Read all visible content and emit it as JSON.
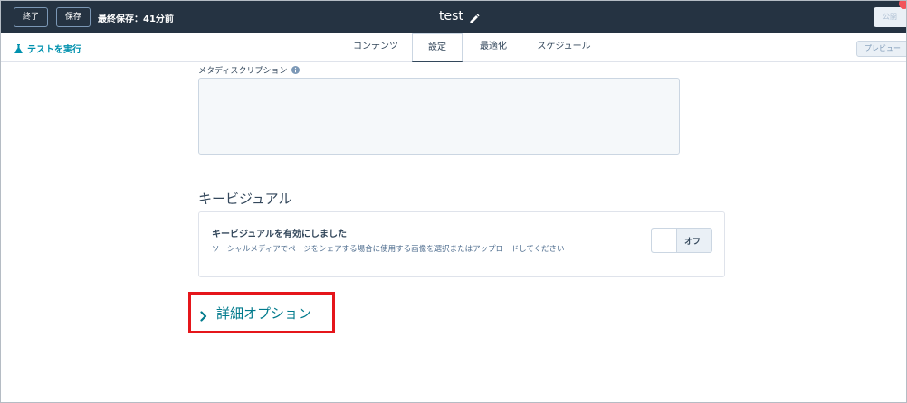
{
  "topbar": {
    "exit_label": "終了",
    "save_label": "保存",
    "last_saved": "最終保存：41分前",
    "page_name": "test",
    "publish_label": "公開"
  },
  "subbar": {
    "run_test_label": "テストを実行",
    "tabs": [
      {
        "label": "コンテンツ"
      },
      {
        "label": "設定"
      },
      {
        "label": "最適化"
      },
      {
        "label": "スケジュール"
      }
    ],
    "active_tab": "設定",
    "preview_label": "プレビュー"
  },
  "settings": {
    "meta_description_label": "メタディスクリプション",
    "meta_description_value": "",
    "key_visual": {
      "heading": "キービジュアル",
      "card_title": "キービジュアルを有効にしました",
      "card_description": "ソーシャルメディアでページをシェアする場合に使用する画像を選択またはアップロードしてください",
      "toggle_label": "オフ"
    },
    "advanced_options_label": "詳細オプション"
  },
  "colors": {
    "topbar_bg": "#253342",
    "accent": "#0091ae",
    "highlight_box": "#e5161b",
    "notification": "#f2545b"
  },
  "icons": [
    "pencil-icon",
    "flask-icon",
    "info-icon",
    "chevron-right-icon"
  ]
}
